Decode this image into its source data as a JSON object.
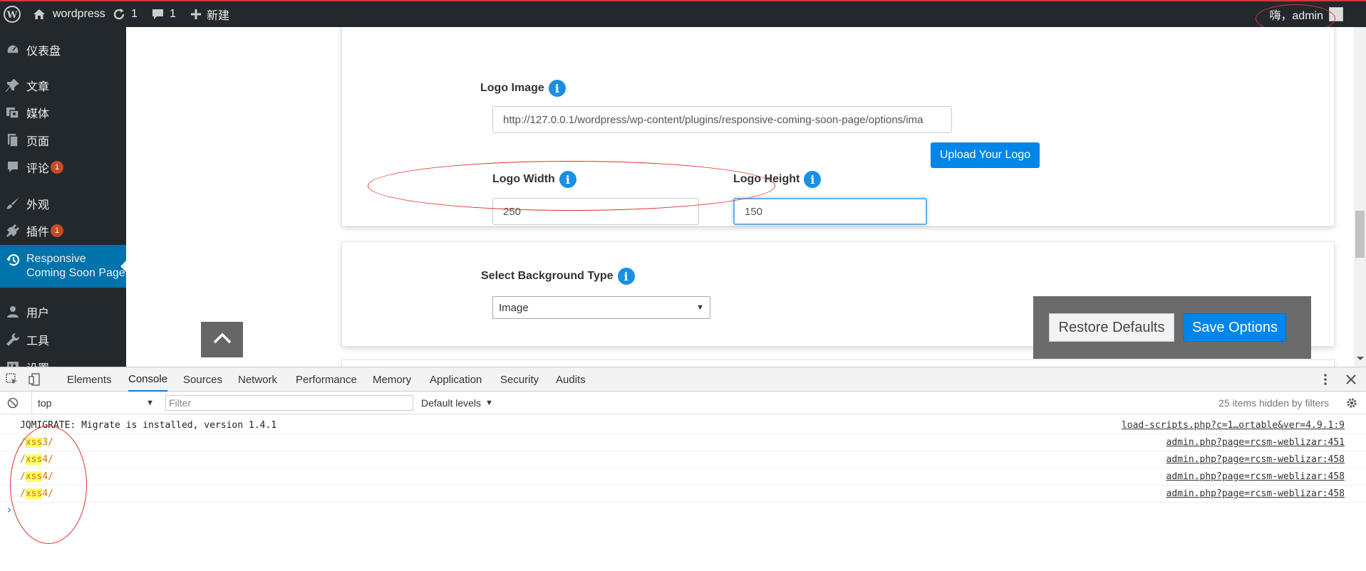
{
  "adminbar": {
    "site_name": "wordpress",
    "updates_count": "1",
    "comments_count": "1",
    "new_label": "新建",
    "greeting": "嗨，admin"
  },
  "sidebar": {
    "items": [
      {
        "label": "仪表盘",
        "icon": "dashboard-icon"
      },
      {
        "label": "文章",
        "icon": "pin-icon"
      },
      {
        "label": "媒体",
        "icon": "media-icon"
      },
      {
        "label": "页面",
        "icon": "page-icon"
      },
      {
        "label": "评论",
        "icon": "comment-icon",
        "badge": "1"
      },
      {
        "label": "外观",
        "icon": "brush-icon"
      },
      {
        "label": "插件",
        "icon": "plugin-icon",
        "badge": "1"
      },
      {
        "label": "Responsive Coming Soon Page",
        "icon": "history-icon",
        "current": true
      },
      {
        "label": "用户",
        "icon": "user-icon"
      },
      {
        "label": "工具",
        "icon": "wrench-icon"
      },
      {
        "label": "设置",
        "icon": "settings-icon"
      }
    ]
  },
  "logo_section": {
    "logo_image_label": "Logo Image",
    "logo_url": "http://127.0.0.1/wordpress/wp-content/plugins/responsive-coming-soon-page/options/ima",
    "upload_button": "Upload Your Logo",
    "logo_width_label": "Logo Width",
    "logo_width_value": "250",
    "logo_height_label": "Logo Height",
    "logo_height_value": "150"
  },
  "background_section": {
    "label": "Select Background Type",
    "selected": "Image"
  },
  "actions": {
    "restore_label": "Restore Defaults",
    "save_label": "Save Options"
  },
  "devtools": {
    "tabs": [
      "Elements",
      "Console",
      "Sources",
      "Network",
      "Performance",
      "Memory",
      "Application",
      "Security",
      "Audits"
    ],
    "active_tab": "Console",
    "context": "top",
    "filter_placeholder": "Filter",
    "levels": "Default levels",
    "hidden_info": "25 items hidden by filters",
    "logs": [
      {
        "pre": "JQMIGRATE: Migrate is installed, version 1.4.1",
        "hl": "",
        "post": "",
        "source": "load-scripts.php?c=1…ortable&ver=4.9.1:9"
      },
      {
        "pre": "/",
        "hl": "xss",
        "post": "3/",
        "source": "admin.php?page=rcsm-weblizar:451"
      },
      {
        "pre": "/",
        "hl": "xss",
        "post": "4/",
        "source": "admin.php?page=rcsm-weblizar:458"
      },
      {
        "pre": "/",
        "hl": "xss",
        "post": "4/",
        "source": "admin.php?page=rcsm-weblizar:458"
      },
      {
        "pre": "/",
        "hl": "xss",
        "post": "4/",
        "source": "admin.php?page=rcsm-weblizar:458"
      }
    ],
    "prompt": "›"
  },
  "colors": {
    "adminbar_bg": "#23282d",
    "sidebar_current": "#0073aa",
    "button_blue": "#0085e8",
    "badge": "#ca4a1f",
    "annotation": "#e03030"
  }
}
